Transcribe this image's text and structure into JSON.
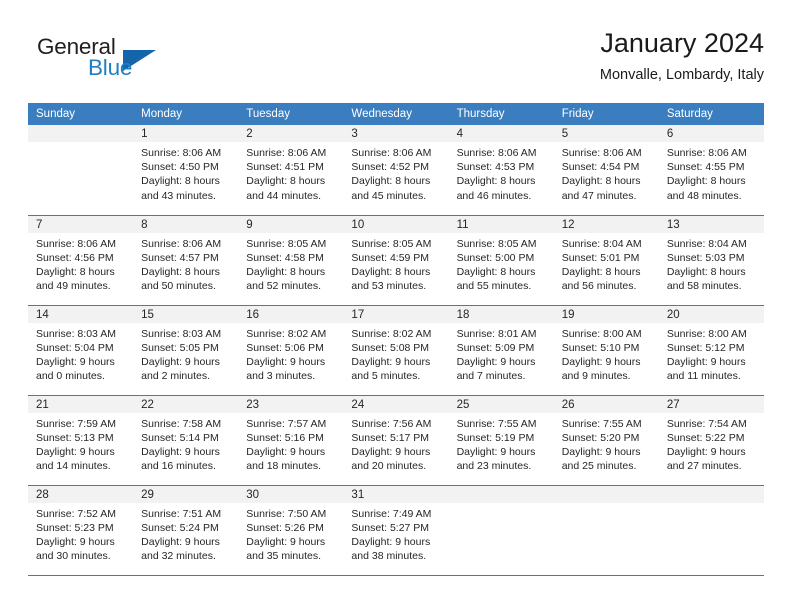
{
  "brand": {
    "name_part1": "General",
    "name_part2": "Blue",
    "triangle_color": "#1565ad",
    "blue_color": "#1f7fc4"
  },
  "header": {
    "month_title": "January 2024",
    "location": "Monvalle, Lombardy, Italy"
  },
  "theme": {
    "header_bg": "#3a7ec0",
    "daynum_bg": "#f2f2f2",
    "text_color": "#262626"
  },
  "weekday_headers": [
    "Sunday",
    "Monday",
    "Tuesday",
    "Wednesday",
    "Thursday",
    "Friday",
    "Saturday"
  ],
  "weeks": [
    [
      {
        "day": "",
        "empty": true,
        "sunrise": "",
        "sunset": "",
        "daylight1": "",
        "daylight2": ""
      },
      {
        "day": "1",
        "sunrise": "Sunrise: 8:06 AM",
        "sunset": "Sunset: 4:50 PM",
        "daylight1": "Daylight: 8 hours",
        "daylight2": "and 43 minutes."
      },
      {
        "day": "2",
        "sunrise": "Sunrise: 8:06 AM",
        "sunset": "Sunset: 4:51 PM",
        "daylight1": "Daylight: 8 hours",
        "daylight2": "and 44 minutes."
      },
      {
        "day": "3",
        "sunrise": "Sunrise: 8:06 AM",
        "sunset": "Sunset: 4:52 PM",
        "daylight1": "Daylight: 8 hours",
        "daylight2": "and 45 minutes."
      },
      {
        "day": "4",
        "sunrise": "Sunrise: 8:06 AM",
        "sunset": "Sunset: 4:53 PM",
        "daylight1": "Daylight: 8 hours",
        "daylight2": "and 46 minutes."
      },
      {
        "day": "5",
        "sunrise": "Sunrise: 8:06 AM",
        "sunset": "Sunset: 4:54 PM",
        "daylight1": "Daylight: 8 hours",
        "daylight2": "and 47 minutes."
      },
      {
        "day": "6",
        "sunrise": "Sunrise: 8:06 AM",
        "sunset": "Sunset: 4:55 PM",
        "daylight1": "Daylight: 8 hours",
        "daylight2": "and 48 minutes."
      }
    ],
    [
      {
        "day": "7",
        "sunrise": "Sunrise: 8:06 AM",
        "sunset": "Sunset: 4:56 PM",
        "daylight1": "Daylight: 8 hours",
        "daylight2": "and 49 minutes."
      },
      {
        "day": "8",
        "sunrise": "Sunrise: 8:06 AM",
        "sunset": "Sunset: 4:57 PM",
        "daylight1": "Daylight: 8 hours",
        "daylight2": "and 50 minutes."
      },
      {
        "day": "9",
        "sunrise": "Sunrise: 8:05 AM",
        "sunset": "Sunset: 4:58 PM",
        "daylight1": "Daylight: 8 hours",
        "daylight2": "and 52 minutes."
      },
      {
        "day": "10",
        "sunrise": "Sunrise: 8:05 AM",
        "sunset": "Sunset: 4:59 PM",
        "daylight1": "Daylight: 8 hours",
        "daylight2": "and 53 minutes."
      },
      {
        "day": "11",
        "sunrise": "Sunrise: 8:05 AM",
        "sunset": "Sunset: 5:00 PM",
        "daylight1": "Daylight: 8 hours",
        "daylight2": "and 55 minutes."
      },
      {
        "day": "12",
        "sunrise": "Sunrise: 8:04 AM",
        "sunset": "Sunset: 5:01 PM",
        "daylight1": "Daylight: 8 hours",
        "daylight2": "and 56 minutes."
      },
      {
        "day": "13",
        "sunrise": "Sunrise: 8:04 AM",
        "sunset": "Sunset: 5:03 PM",
        "daylight1": "Daylight: 8 hours",
        "daylight2": "and 58 minutes."
      }
    ],
    [
      {
        "day": "14",
        "sunrise": "Sunrise: 8:03 AM",
        "sunset": "Sunset: 5:04 PM",
        "daylight1": "Daylight: 9 hours",
        "daylight2": "and 0 minutes."
      },
      {
        "day": "15",
        "sunrise": "Sunrise: 8:03 AM",
        "sunset": "Sunset: 5:05 PM",
        "daylight1": "Daylight: 9 hours",
        "daylight2": "and 2 minutes."
      },
      {
        "day": "16",
        "sunrise": "Sunrise: 8:02 AM",
        "sunset": "Sunset: 5:06 PM",
        "daylight1": "Daylight: 9 hours",
        "daylight2": "and 3 minutes."
      },
      {
        "day": "17",
        "sunrise": "Sunrise: 8:02 AM",
        "sunset": "Sunset: 5:08 PM",
        "daylight1": "Daylight: 9 hours",
        "daylight2": "and 5 minutes."
      },
      {
        "day": "18",
        "sunrise": "Sunrise: 8:01 AM",
        "sunset": "Sunset: 5:09 PM",
        "daylight1": "Daylight: 9 hours",
        "daylight2": "and 7 minutes."
      },
      {
        "day": "19",
        "sunrise": "Sunrise: 8:00 AM",
        "sunset": "Sunset: 5:10 PM",
        "daylight1": "Daylight: 9 hours",
        "daylight2": "and 9 minutes."
      },
      {
        "day": "20",
        "sunrise": "Sunrise: 8:00 AM",
        "sunset": "Sunset: 5:12 PM",
        "daylight1": "Daylight: 9 hours",
        "daylight2": "and 11 minutes."
      }
    ],
    [
      {
        "day": "21",
        "sunrise": "Sunrise: 7:59 AM",
        "sunset": "Sunset: 5:13 PM",
        "daylight1": "Daylight: 9 hours",
        "daylight2": "and 14 minutes."
      },
      {
        "day": "22",
        "sunrise": "Sunrise: 7:58 AM",
        "sunset": "Sunset: 5:14 PM",
        "daylight1": "Daylight: 9 hours",
        "daylight2": "and 16 minutes."
      },
      {
        "day": "23",
        "sunrise": "Sunrise: 7:57 AM",
        "sunset": "Sunset: 5:16 PM",
        "daylight1": "Daylight: 9 hours",
        "daylight2": "and 18 minutes."
      },
      {
        "day": "24",
        "sunrise": "Sunrise: 7:56 AM",
        "sunset": "Sunset: 5:17 PM",
        "daylight1": "Daylight: 9 hours",
        "daylight2": "and 20 minutes."
      },
      {
        "day": "25",
        "sunrise": "Sunrise: 7:55 AM",
        "sunset": "Sunset: 5:19 PM",
        "daylight1": "Daylight: 9 hours",
        "daylight2": "and 23 minutes."
      },
      {
        "day": "26",
        "sunrise": "Sunrise: 7:55 AM",
        "sunset": "Sunset: 5:20 PM",
        "daylight1": "Daylight: 9 hours",
        "daylight2": "and 25 minutes."
      },
      {
        "day": "27",
        "sunrise": "Sunrise: 7:54 AM",
        "sunset": "Sunset: 5:22 PM",
        "daylight1": "Daylight: 9 hours",
        "daylight2": "and 27 minutes."
      }
    ],
    [
      {
        "day": "28",
        "sunrise": "Sunrise: 7:52 AM",
        "sunset": "Sunset: 5:23 PM",
        "daylight1": "Daylight: 9 hours",
        "daylight2": "and 30 minutes."
      },
      {
        "day": "29",
        "sunrise": "Sunrise: 7:51 AM",
        "sunset": "Sunset: 5:24 PM",
        "daylight1": "Daylight: 9 hours",
        "daylight2": "and 32 minutes."
      },
      {
        "day": "30",
        "sunrise": "Sunrise: 7:50 AM",
        "sunset": "Sunset: 5:26 PM",
        "daylight1": "Daylight: 9 hours",
        "daylight2": "and 35 minutes."
      },
      {
        "day": "31",
        "sunrise": "Sunrise: 7:49 AM",
        "sunset": "Sunset: 5:27 PM",
        "daylight1": "Daylight: 9 hours",
        "daylight2": "and 38 minutes."
      },
      {
        "day": "",
        "empty": true,
        "sunrise": "",
        "sunset": "",
        "daylight1": "",
        "daylight2": ""
      },
      {
        "day": "",
        "empty": true,
        "sunrise": "",
        "sunset": "",
        "daylight1": "",
        "daylight2": ""
      },
      {
        "day": "",
        "empty": true,
        "sunrise": "",
        "sunset": "",
        "daylight1": "",
        "daylight2": ""
      }
    ]
  ]
}
